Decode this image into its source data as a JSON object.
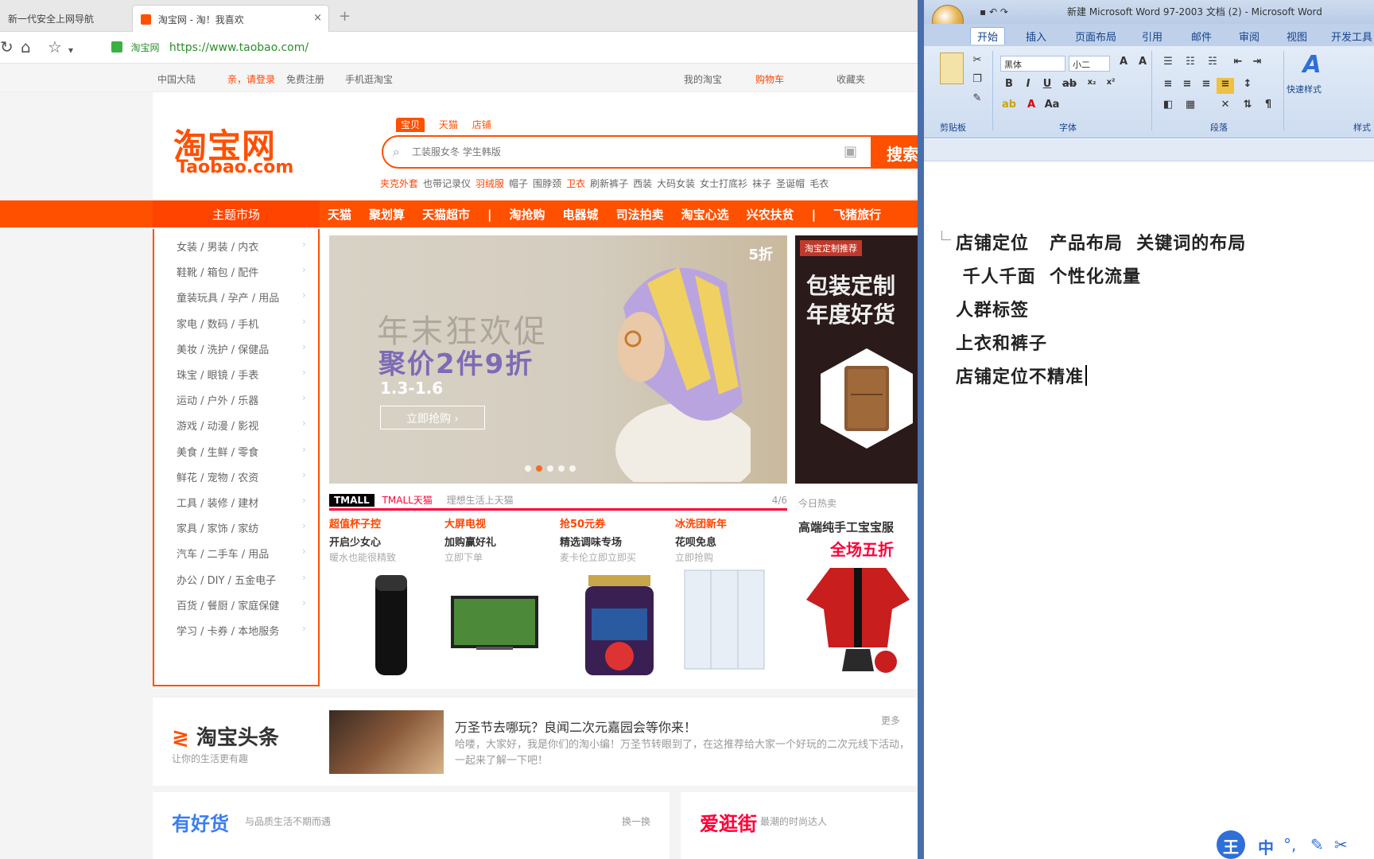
{
  "browser": {
    "tabs": [
      {
        "label": "新一代安全上网导航"
      },
      {
        "label": "淘宝网 - 淘！我喜欢"
      }
    ],
    "new_tab": "+",
    "close_tab": "×",
    "url": "https://www.taobao.com/",
    "site_badge": "淘宝网"
  },
  "taobao": {
    "site_nav": {
      "region": "中国大陆",
      "login": "亲，请登录",
      "register": "免费注册",
      "mobile": "手机逛淘宝",
      "my_taobao": "我的淘宝",
      "cart": "购物车",
      "favorites": "收藏夹"
    },
    "logo_cn": "淘宝网",
    "logo_en": "Taobao.com",
    "search": {
      "tabs": [
        "宝贝",
        "天猫",
        "店铺"
      ],
      "placeholder": "工装服女冬 学生韩版",
      "button": "搜索"
    },
    "hotwords": [
      "夹克外套",
      "也带记录仪",
      "羽绒服",
      "帽子",
      "围脖颈",
      "卫衣",
      "刷新裤子",
      "西装",
      "大码女装",
      "女士打底衫",
      "袜子",
      "圣诞帽",
      "毛衣"
    ],
    "main_market": "主题市场",
    "top_links": [
      "天猫",
      "聚划算",
      "天猫超市",
      "|",
      "淘抢购",
      "电器城",
      "司法拍卖",
      "淘宝心选",
      "兴农扶贫",
      "|",
      "飞猪旅行"
    ],
    "categories": [
      "女装 / 男装 / 内衣",
      "鞋靴 / 箱包 / 配件",
      "童装玩具 / 孕产 / 用品",
      "家电 / 数码 / 手机",
      "美妆 / 洗护 / 保健品",
      "珠宝 / 眼镜 / 手表",
      "运动 / 户外 / 乐器",
      "游戏 / 动漫 / 影视",
      "美食 / 生鲜 / 零食",
      "鲜花 / 宠物 / 农资",
      "工具 / 装修 / 建材",
      "家具 / 家饰 / 家纺",
      "汽车 / 二手车 / 用品",
      "办公 / DIY / 五金电子",
      "百货 / 餐厨 / 家庭保健",
      "学习 / 卡券 / 本地服务"
    ],
    "banner": {
      "title": "年末狂欢促",
      "subtitle": "聚价2件9折",
      "date": "1.3-1.6",
      "button": "立即抢购 ›",
      "tag": "5折"
    },
    "promo": {
      "tag": "淘宝定制推荐",
      "line1": "包装定制",
      "line2": "年度好货"
    },
    "tmall": {
      "logo": "TMALL",
      "name": "TMALL天猫",
      "sub": "理想生活上天猫",
      "page": "4/6",
      "items": [
        {
          "kicker": "超值杯子控",
          "name": "开启少女心",
          "desc": "暖水也能很精致"
        },
        {
          "kicker": "大屏电视",
          "name": "加购赢好礼",
          "desc": "立即下单"
        },
        {
          "kicker": "抢50元券",
          "name": "精选调味专场",
          "desc": "麦卡伦立即立即买"
        },
        {
          "kicker": "冰洗团新年",
          "name": "花呗免息",
          "desc": "立即抢购"
        }
      ]
    },
    "aside": {
      "label": "今日热卖",
      "title": "高端纯手工宝宝服",
      "sale": "全场五折"
    },
    "headlines": {
      "logo": "淘宝头条",
      "sub": "让你的生活更有趣",
      "title": "万圣节去哪玩？良闻二次元嘉园会等你来！",
      "text": "哈喽，大家好，我是你们的淘小编！万圣节转眼到了，在这推荐给大家一个好玩的二次元线下活动，一起来了解一下吧！",
      "more": "更多"
    },
    "goods": {
      "title": "有好货",
      "sub": "与品质生活不期而遇",
      "more": "换一换"
    },
    "love": {
      "title": "爱逛街",
      "sub": "最潮的时尚达人"
    }
  },
  "word": {
    "title": "新建 Microsoft Word 97-2003 文档 (2) - Microsoft Word",
    "tabs": [
      "开始",
      "插入",
      "页面布局",
      "引用",
      "邮件",
      "审阅",
      "视图",
      "开发工具"
    ],
    "font_name": "黑体",
    "font_size": "小二",
    "groups": [
      "剪贴板",
      "字体",
      "段落",
      "样式"
    ],
    "style_button": "快速样式",
    "lines": [
      "店铺定位   产品布局  关键词的布局",
      " 千人千面  个性化流量",
      "人群标签",
      "上衣和裤子",
      "店铺定位不精准"
    ]
  },
  "ime": {
    "logo": "王",
    "lang": "中",
    "icons": [
      "°,",
      "✎",
      "✂"
    ]
  },
  "colors": {
    "taobao_orange": "#ff5000",
    "tmall_red": "#ff0036",
    "word_blue": "#15428b"
  }
}
